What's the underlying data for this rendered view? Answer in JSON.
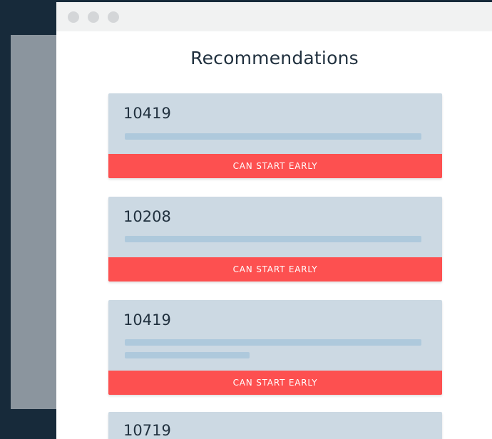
{
  "page": {
    "title": "Recommendations"
  },
  "cards": [
    {
      "number": "10419",
      "badge": "CAN START EARLY"
    },
    {
      "number": "10208",
      "badge": "CAN START EARLY"
    },
    {
      "number": "10419",
      "badge": "CAN START EARLY"
    },
    {
      "number": "10719"
    }
  ],
  "colors": {
    "background": "#172a3a",
    "card": "#ccd9e3",
    "bar": "#aec9dc",
    "badge": "#fd5050",
    "text": "#21313f"
  }
}
